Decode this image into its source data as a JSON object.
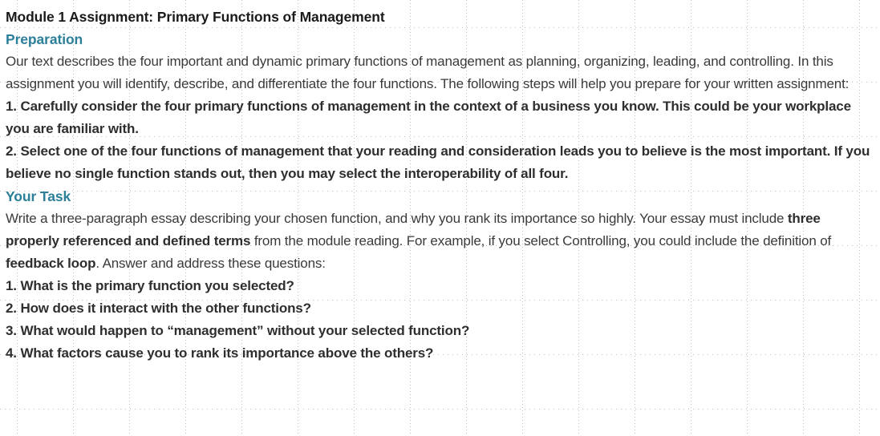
{
  "document": {
    "title": "Module 1 Assignment: Primary Functions of Management",
    "sections": [
      {
        "heading": "Preparation",
        "intro": "Our text describes the four important and dynamic primary functions of management as planning, organizing, leading, and controlling. In this assignment you will identify, describe, and differentiate the four functions. The following steps will help you prepare for your written assignment:",
        "steps": [
          "1. Carefully consider the four primary functions of management in the context of a business you know. This could be your workplace you are familiar with.",
          "2. Select one of the four functions of management that your reading and consideration leads you to believe is the most important. If you believe no single function stands out, then you may select the interoperability of all four."
        ]
      },
      {
        "heading": "Your Task",
        "task_part_1": "Write a three-paragraph essay describing your chosen function, and why you rank its importance so highly. Your essay must include ",
        "task_bold_1": "three properly referenced and defined terms",
        "task_part_2": " from the module reading. For example, if you select Controlling, you could include the definition of ",
        "task_bold_2": "feedback loop",
        "task_part_3": ". Answer and address these questions:",
        "questions": [
          "1. What is the primary function you selected?",
          "2. How does it interact with the other functions?",
          "3. What would happen to “management” without your selected function?",
          "4. What factors cause you to rank its importance above the others?"
        ]
      }
    ]
  },
  "style": {
    "heading_color": "#2b7f99",
    "title_color": "#1a1a1a",
    "body_color": "#3a3a3a",
    "grid_color": "#bfbfc9",
    "page_background": "#ffffff"
  }
}
